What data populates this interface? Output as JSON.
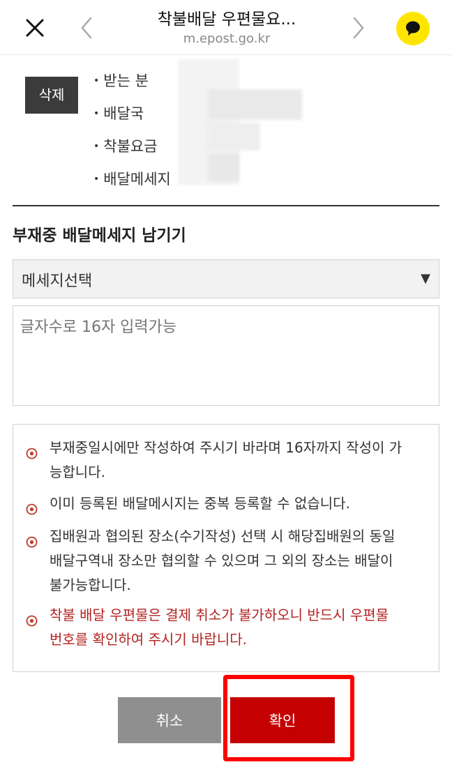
{
  "header": {
    "title": "착불배달 우편물요...",
    "url": "m.epost.go.kr",
    "close_icon": "close-icon",
    "back_icon": "chevron-left-icon",
    "forward_icon": "chevron-right-icon",
    "kakao_icon": "kakaotalk-icon"
  },
  "delivery_info": {
    "delete_label": "삭제",
    "fields": [
      {
        "label": "받는 분"
      },
      {
        "label": "배달국"
      },
      {
        "label": "착불요금"
      },
      {
        "label": "배달메세지"
      }
    ]
  },
  "message_section": {
    "title": "부재중 배달메세지 남기기",
    "select_value": "메세지선택",
    "select_arrow": "▼",
    "textarea_placeholder": "글자수로 16자 입력가능"
  },
  "notices": [
    {
      "lines": [
        "부재중일시에만 작성하여 주시기 바라며 16자까지 작성이 가",
        "능합니다."
      ],
      "color": "#333333"
    },
    {
      "lines": [
        "이미 등록된 배달메시지는 중복 등록할 수 없습니다."
      ],
      "color": "#333333"
    },
    {
      "lines": [
        "집배원과 협의된 장소(수기작성) 선택 시 해당집배원의 동일",
        "배달구역내 장소만 협의할 수 있으며 그 외의 장소는 배달이",
        "불가능합니다."
      ],
      "color": "#333333"
    },
    {
      "lines": [
        "착불 배달 우편물은 결제 취소가 불가하오니 반드시 우편물",
        "번호를 확인하여 주시기 바랍니다."
      ],
      "color": "#b32222"
    }
  ],
  "buttons": {
    "cancel_label": "취소",
    "confirm_label": "확인"
  },
  "colors": {
    "accent": "#c40000",
    "highlight": "#ff0000",
    "notice_icon": "#c0392b",
    "kakao": "#fee500"
  }
}
